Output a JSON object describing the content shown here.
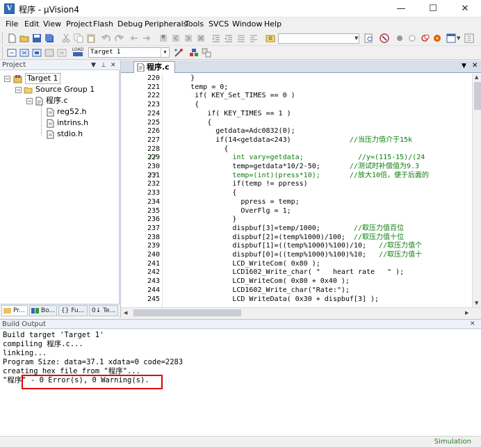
{
  "window": {
    "title": "程序 - µVision4",
    "app_icon_glyph": "V",
    "minimize_glyph": "—",
    "maximize_glyph": "☐",
    "close_glyph": "✕"
  },
  "menu": [
    "File",
    "Edit",
    "View",
    "Project",
    "Flash",
    "Debug",
    "Peripherals",
    "Tools",
    "SVCS",
    "Window",
    "Help"
  ],
  "toolbar": {
    "target_combo": "Target 1",
    "find_combo": "",
    "load_label": "LOAD"
  },
  "project_panel": {
    "title": "Project",
    "tree": {
      "target": "Target 1",
      "group": "Source Group 1",
      "file": "程序.c",
      "headers": [
        "reg52.h",
        "intrins.h",
        "stdio.h"
      ]
    },
    "tabs": [
      "Pr...",
      "Bo...",
      "{} Fu...",
      "0↓ Te..."
    ]
  },
  "editor": {
    "active_tab": "程序.c",
    "lines": [
      {
        "n": "220",
        "code": "      }"
      },
      {
        "n": "221",
        "code": "      temp = 0;"
      },
      {
        "n": "222",
        "code": "       if( KEY_Set_TIMES == 0 )"
      },
      {
        "n": "223",
        "code": "       {"
      },
      {
        "n": "224",
        "code": "          if( KEY_TIMES == 1 )"
      },
      {
        "n": "225",
        "code": "          {"
      },
      {
        "n": "226",
        "code": "            getdata=Adc0832(0);"
      },
      {
        "n": "227",
        "code": "            if(14<getdata<243)",
        "comment": "              //当压力值介于15k"
      },
      {
        "n": "228",
        "code": "              {"
      },
      {
        "n": "229",
        "prefix": "//",
        "code": "                int vary=getdata;",
        "comment": "             //y=(115-15)/(24"
      },
      {
        "n": "230",
        "code": "                temp=getdata*10/2-50;",
        "comment": "       //测试时补偿值为9.3"
      },
      {
        "n": "231",
        "prefix": "//",
        "code": "                temp=(int)(press*10);",
        "comment": "       //放大10倍，便于后面的"
      },
      {
        "n": "232",
        "code": "                if(temp != ppress)"
      },
      {
        "n": "233",
        "code": "                {"
      },
      {
        "n": "234",
        "code": "                  ppress = temp;"
      },
      {
        "n": "235",
        "code": "                  OverFlg = 1;"
      },
      {
        "n": "236",
        "code": "                }"
      },
      {
        "n": "237",
        "code": "                dispbuf[3]=temp/1000;",
        "comment": "        //取压力值百位"
      },
      {
        "n": "238",
        "code": "                dispbuf[2]=(temp%1000)/100;",
        "comment": "  //取压力值十位"
      },
      {
        "n": "239",
        "code": "                dispbuf[1]=((temp%1000)%100)/10;",
        "comment": "   //取压力值个"
      },
      {
        "n": "240",
        "code": "                dispbuf[0]=((temp%1000)%100)%10;",
        "comment": "   //取压力值十"
      },
      {
        "n": "241",
        "code": "                LCD_WriteCom( 0x80 );"
      },
      {
        "n": "242",
        "code": "                LCD1602_Write_char( \"   heart rate   \" );"
      },
      {
        "n": "243",
        "code": "                LCD_WriteCom( 0x80 + 0x40 );"
      },
      {
        "n": "244",
        "code": "                LCD1602_Write_char(\"Rate:\");"
      },
      {
        "n": "245",
        "code": "                LCD WriteData( 0x30 + dispbuf[3] );"
      }
    ]
  },
  "build_output": {
    "title": "Build Output",
    "lines": [
      "Build target 'Target 1'",
      "compiling 程序.c...",
      "linking...",
      "Program Size: data=37.1 xdata=0 code=2283",
      "creating hex file from \"程序\"...",
      "\"程序\" - 0 Error(s), 0 Warning(s)."
    ]
  },
  "status": {
    "mode": "Simulation"
  },
  "colors": {
    "comment": "#0a7d0a",
    "highlight_box": "#e00000",
    "status_green": "#2a7d2a"
  }
}
